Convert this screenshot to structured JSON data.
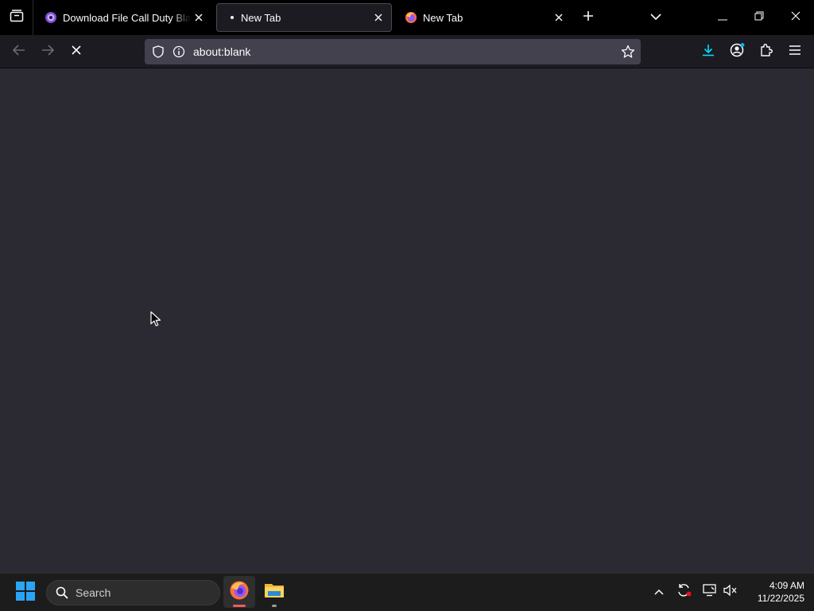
{
  "browser": {
    "tabs": [
      {
        "title": "Download File Call Duty Black Ops",
        "close_label": "×"
      },
      {
        "title": "New Tab",
        "close_label": "×"
      },
      {
        "title": "New Tab",
        "close_label": "×"
      }
    ],
    "active_tab_index": 1,
    "address": {
      "value": "about:blank"
    },
    "icons": {
      "tab_list": "tab-list-icon",
      "new_tab": "plus-icon",
      "all_tabs": "chevron-down-icon",
      "back": "back-arrow-icon",
      "forward": "forward-arrow-icon",
      "stop": "stop-x-icon",
      "shield": "shield-icon",
      "info": "info-icon",
      "bookmark": "star-icon",
      "downloads": "download-icon",
      "account": "account-icon",
      "extensions": "puzzle-icon",
      "menu": "hamburger-menu-icon"
    },
    "colors": {
      "tabstrip": "#000000",
      "toolbar": "#1c1b22",
      "urlbar": "#42414d",
      "content": "#2b2a33",
      "download_accent": "#00ddff"
    }
  },
  "taskbar": {
    "search_label": "Search",
    "clock": {
      "time": "4:09 AM",
      "date": "11/22/2025"
    },
    "apps": [
      "Firefox",
      "File Explorer"
    ],
    "colors": {
      "background": "#1c1c1c",
      "windows_blue": "#2aa4f4",
      "firefox_indicator": "#f35b5b"
    }
  }
}
